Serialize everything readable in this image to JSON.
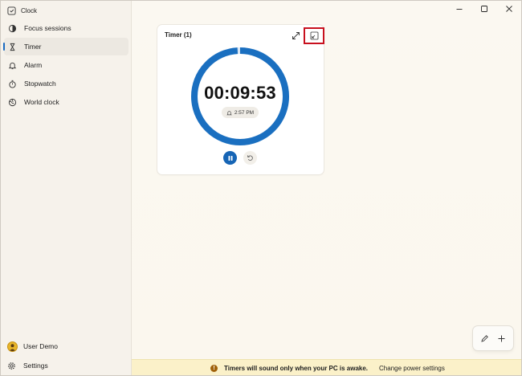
{
  "app": {
    "title": "Clock"
  },
  "sidebar": {
    "items": [
      {
        "label": "Focus sessions",
        "icon": "focus-icon",
        "active": false
      },
      {
        "label": "Timer",
        "icon": "hourglass-icon",
        "active": true
      },
      {
        "label": "Alarm",
        "icon": "bell-icon",
        "active": false
      },
      {
        "label": "Stopwatch",
        "icon": "stopwatch-icon",
        "active": false
      },
      {
        "label": "World clock",
        "icon": "globe-icon",
        "active": false
      }
    ],
    "user": {
      "name": "User Demo"
    },
    "settings": {
      "label": "Settings"
    }
  },
  "timer": {
    "title": "Timer (1)",
    "remaining": "00:09:53",
    "end_time": "2:57 PM",
    "progress": 0.99
  },
  "infobar": {
    "message": "Timers will sound only when your PC is awake.",
    "link": "Change power settings"
  },
  "colors": {
    "accent": "#1665b5",
    "ring": "#1a6fc0",
    "highlight_box": "#c8101e",
    "infobar_bg": "#fbf1c9"
  }
}
